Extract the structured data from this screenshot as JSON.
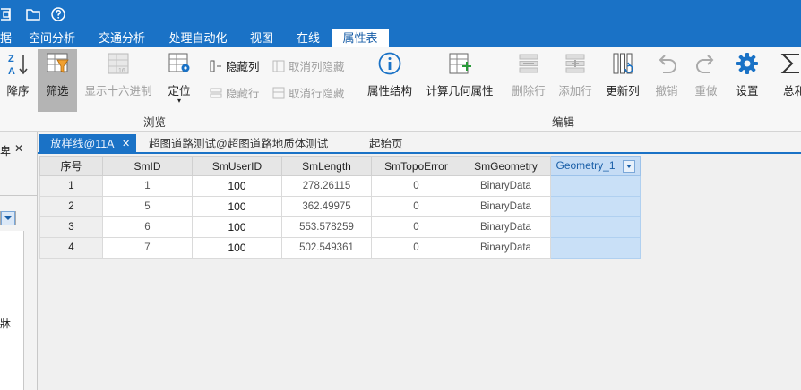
{
  "menu": {
    "tabs": [
      {
        "label": "据"
      },
      {
        "label": "空间分析"
      },
      {
        "label": "交通分析"
      },
      {
        "label": "处理自动化"
      },
      {
        "label": "视图"
      },
      {
        "label": "在线"
      },
      {
        "label": "属性表",
        "active": true
      }
    ]
  },
  "ribbon": {
    "sort": "降序",
    "filter": "筛选",
    "show_hex": "显示十六进制",
    "locate": "定位",
    "hide_col": "隐藏列",
    "unhide_col": "取消列隐藏",
    "hide_row": "隐藏行",
    "unhide_row": "取消行隐藏",
    "browse_group": "浏览",
    "attr_struct": "属性结构",
    "calc_geom": "计算几何属性",
    "delete_row": "删除行",
    "add_row": "添加行",
    "update_col": "更新列",
    "undo": "撤销",
    "redo": "重做",
    "settings": "设置",
    "edit_group": "编辑",
    "summary_partial": "总和"
  },
  "left_panel": {
    "close_glyph": "✕",
    "text_top": "卑",
    "text_mid": "牀"
  },
  "doc_tabs": [
    {
      "label": "放样线@11A",
      "active": true
    },
    {
      "label": "超图道路测试@超图道路地质体测试"
    },
    {
      "label": "起始页"
    }
  ],
  "doc_tab_close": "✕",
  "table": {
    "columns": [
      "序号",
      "SmID",
      "SmUserID",
      "SmLength",
      "SmTopoError",
      "SmGeometry",
      "Geometry_1"
    ],
    "rows": [
      [
        "1",
        "1",
        "100",
        "278.26115",
        "0",
        "BinaryData",
        ""
      ],
      [
        "2",
        "5",
        "100",
        "362.49975",
        "0",
        "BinaryData",
        ""
      ],
      [
        "3",
        "6",
        "100",
        "553.578259",
        "0",
        "BinaryData",
        ""
      ],
      [
        "4",
        "7",
        "100",
        "502.549361",
        "0",
        "BinaryData",
        ""
      ]
    ]
  },
  "colors": {
    "accent": "#1a72c6",
    "selected_column": "#c9e0f7",
    "ribbon_bg": "#f7f7f7"
  }
}
